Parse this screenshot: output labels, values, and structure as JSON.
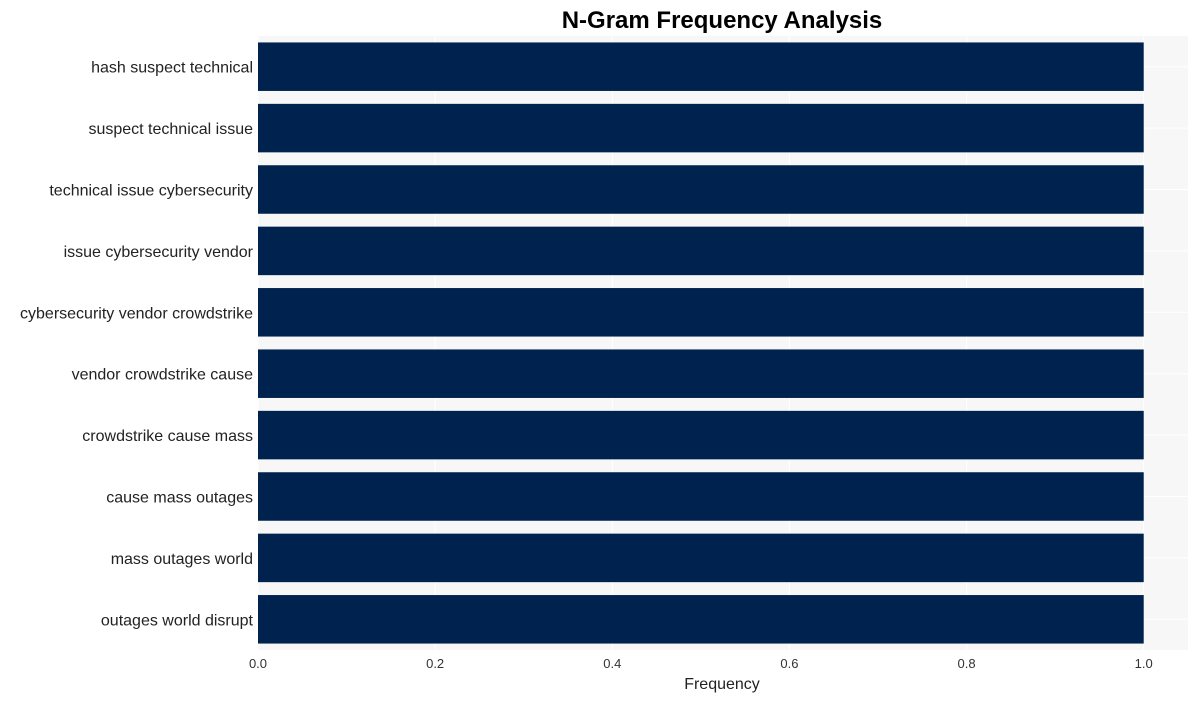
{
  "chart_data": {
    "type": "bar",
    "orientation": "horizontal",
    "title": "N-Gram Frequency Analysis",
    "xlabel": "Frequency",
    "ylabel": "",
    "categories": [
      "hash suspect technical",
      "suspect technical issue",
      "technical issue cybersecurity",
      "issue cybersecurity vendor",
      "cybersecurity vendor crowdstrike",
      "vendor crowdstrike cause",
      "crowdstrike cause mass",
      "cause mass outages",
      "mass outages world",
      "outages world disrupt"
    ],
    "values": [
      1,
      1,
      1,
      1,
      1,
      1,
      1,
      1,
      1,
      1
    ],
    "xticks": [
      "0.0",
      "0.2",
      "0.4",
      "0.6",
      "0.8",
      "1.0"
    ],
    "xtick_values": [
      0,
      0.2,
      0.4,
      0.6,
      0.8,
      1.0
    ],
    "xlim": [
      0,
      1.05
    ],
    "grid": true,
    "legend": "none",
    "colors": {
      "bar": "#00224e",
      "plot_background": "#f7f7f7",
      "grid": "#ffffff"
    }
  }
}
